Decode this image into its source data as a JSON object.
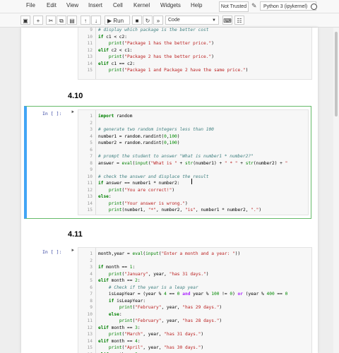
{
  "menubar": {
    "items": [
      "File",
      "Edit",
      "View",
      "Insert",
      "Cell",
      "Kernel",
      "Widgets",
      "Help"
    ],
    "trusted_label": "Not Trusted",
    "kernel_label": "Python 3 (ipykernel)"
  },
  "toolbar": {
    "run_label": "Run",
    "cell_type": "Code",
    "icons": [
      "save-icon",
      "add-cell-icon",
      "cut-icon",
      "copy-icon",
      "paste-icon",
      "move-up-icon",
      "move-down-icon",
      "run-icon",
      "stop-icon",
      "restart-icon",
      "fast-forward-icon",
      "keyboard-icon",
      "command-palette-icon"
    ]
  },
  "cells": [
    {
      "prompt": "",
      "lines": [
        {
          "n": "9",
          "t": "# display which package is the better cost"
        },
        {
          "n": "10",
          "t": "if c1 < c2:"
        },
        {
          "n": "11",
          "t": "    print(\"Package 1 has the better price.\")"
        },
        {
          "n": "12",
          "t": "elif c2 < c1:"
        },
        {
          "n": "13",
          "t": "    print(\"Package 2 has the better price.\")"
        },
        {
          "n": "14",
          "t": "elif c1 == c2:"
        },
        {
          "n": "15",
          "t": "    print(\"Package 1 and Package 2 have the same price.\")"
        }
      ]
    },
    {
      "heading": "4.10",
      "prompt": "In [ ]:",
      "lines": [
        {
          "n": "1",
          "t": "import random"
        },
        {
          "n": "2",
          "t": ""
        },
        {
          "n": "3",
          "t": "# generate two random integers less than 100"
        },
        {
          "n": "4",
          "t": "number1 = random.randint(0,100)"
        },
        {
          "n": "5",
          "t": "number2 = random.randint(0,100)"
        },
        {
          "n": "6",
          "t": ""
        },
        {
          "n": "7",
          "t": "# prompt the student to answer \"What is number1 * number2?\""
        },
        {
          "n": "8",
          "t": "answer = eval(input(\"What is \" + str(number1) + \" * \" + str(number2) + \""
        },
        {
          "n": "9",
          "t": ""
        },
        {
          "n": "10",
          "t": "# check the answer and displace the result"
        },
        {
          "n": "11",
          "t": "if answer == number1 * number2:"
        },
        {
          "n": "12",
          "t": "    print(\"You are correct!\")"
        },
        {
          "n": "13",
          "t": "else:"
        },
        {
          "n": "14",
          "t": "    print(\"Your answer is wrong.\")"
        },
        {
          "n": "15",
          "t": "    print(number1, \"*\", number2, \"is\", number1 * number2, \".\")"
        }
      ]
    },
    {
      "heading": "4.11",
      "prompt": "In [ ]:",
      "lines": [
        {
          "n": "1",
          "t": "month,year = eval(input(\"Enter a month and a year: \"))"
        },
        {
          "n": "2",
          "t": ""
        },
        {
          "n": "3",
          "t": "if month == 1:"
        },
        {
          "n": "4",
          "t": "    print(\"January\", year, \"has 31 days.\")"
        },
        {
          "n": "5",
          "t": "elif month == 2:"
        },
        {
          "n": "6",
          "t": "    # Check if the year is a leap year"
        },
        {
          "n": "7",
          "t": "    isLeapYear = (year % 4 == 0 and year % 100 != 0) or (year % 400 == 0"
        },
        {
          "n": "8",
          "t": "    if isLeapYear:"
        },
        {
          "n": "9",
          "t": "        print(\"February\", year, \"has 29 days.\")"
        },
        {
          "n": "10",
          "t": "    else:"
        },
        {
          "n": "11",
          "t": "        print(\"February\", year, \"has 28 days.\")"
        },
        {
          "n": "12",
          "t": "elif month == 3:"
        },
        {
          "n": "13",
          "t": "    print(\"March\", year, \"has 31 days.\")"
        },
        {
          "n": "14",
          "t": "elif month == 4:"
        },
        {
          "n": "15",
          "t": "    print(\"April\", year, \"has 30 days.\")"
        },
        {
          "n": "16",
          "t": "elif month == 5:"
        }
      ]
    }
  ]
}
